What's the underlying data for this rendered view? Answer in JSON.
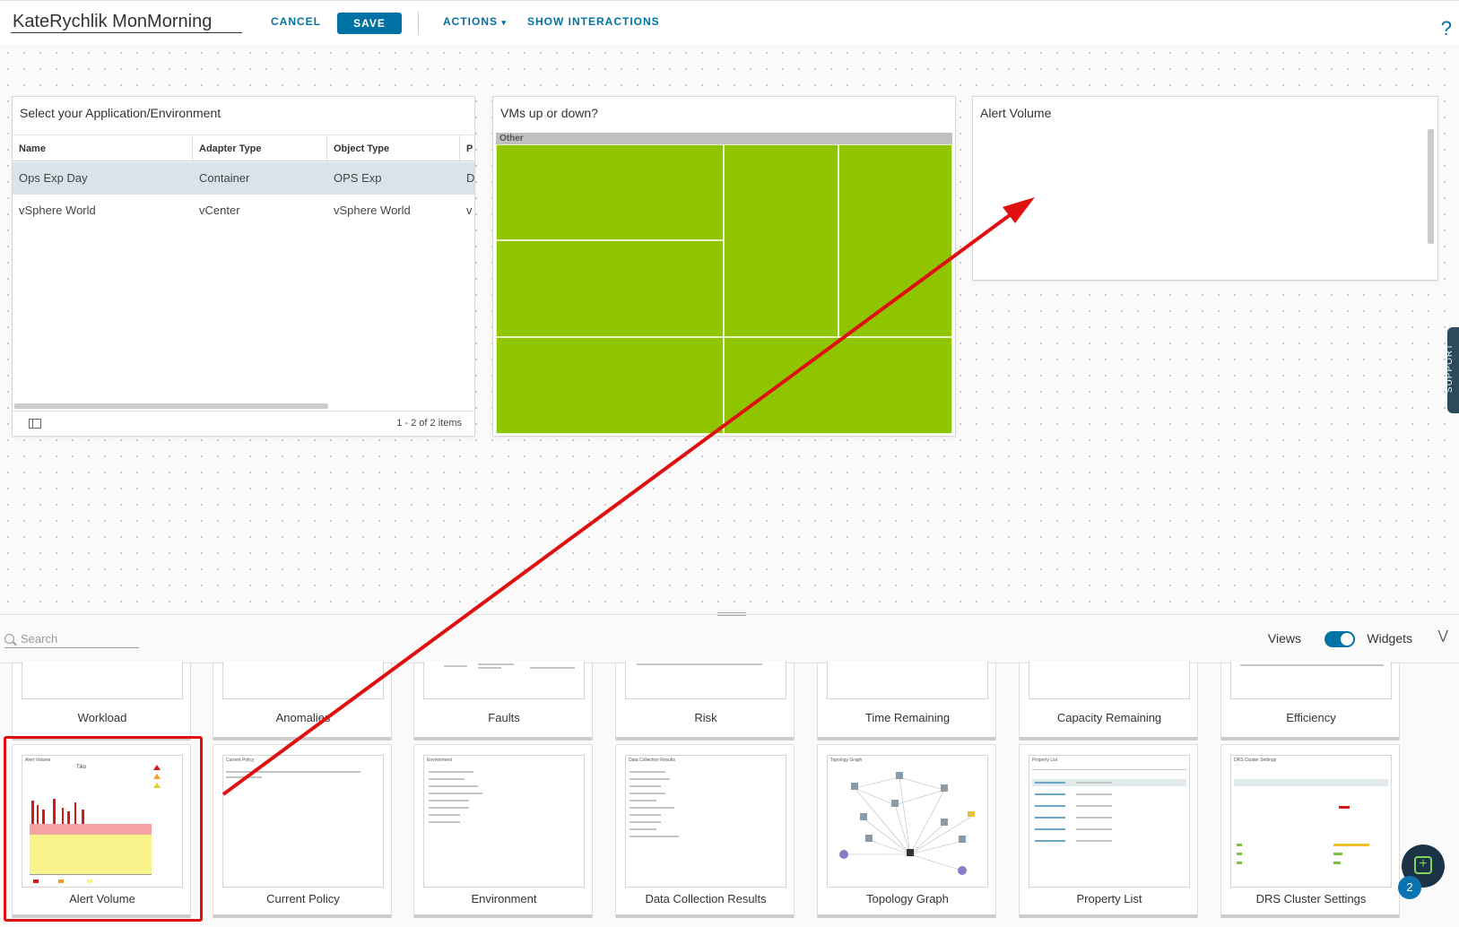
{
  "header": {
    "dashboard_name": "KateRychlik MonMorning",
    "cancel_label": "CANCEL",
    "save_label": "SAVE",
    "actions_label": "ACTIONS",
    "show_interactions_label": "SHOW INTERACTIONS",
    "help_label": "?"
  },
  "widgets": {
    "app_env": {
      "title": "Select your Application/Environment",
      "columns": [
        "Name",
        "Adapter Type",
        "Object Type",
        "P"
      ],
      "rows": [
        [
          "Ops Exp Day",
          "Container",
          "OPS Exp",
          "D"
        ],
        [
          "vSphere World",
          "vCenter",
          "vSphere World",
          "v"
        ]
      ],
      "pager": "1 - 2 of 2 items"
    },
    "vms": {
      "title": "VMs up or down?",
      "group_label": "Other"
    },
    "alert_volume": {
      "title": "Alert Volume"
    }
  },
  "support_label": "SUPPORT",
  "bottom_panel": {
    "search_placeholder": "Search",
    "views_label": "Views",
    "widgets_label": "Widgets",
    "row1": [
      "Workload",
      "Anomalies",
      "Faults",
      "Risk",
      "Time Remaining",
      "Capacity Remaining",
      "Efficiency"
    ],
    "row2": [
      "Alert Volume",
      "Current Policy",
      "Environment",
      "Data Collection Results",
      "Topology Graph",
      "Property List",
      "DRS Cluster Settings"
    ],
    "thumb_titles": [
      "Alert Volume",
      "Current Policy",
      "Environment",
      "Data Collection Results",
      "Topology Graph",
      "Property List",
      "DRS Cluster Settings"
    ],
    "notification_count": "2"
  },
  "colors": {
    "accent": "#0072a3",
    "treemap_green": "#8fc400",
    "highlight_red": "#e01010"
  }
}
